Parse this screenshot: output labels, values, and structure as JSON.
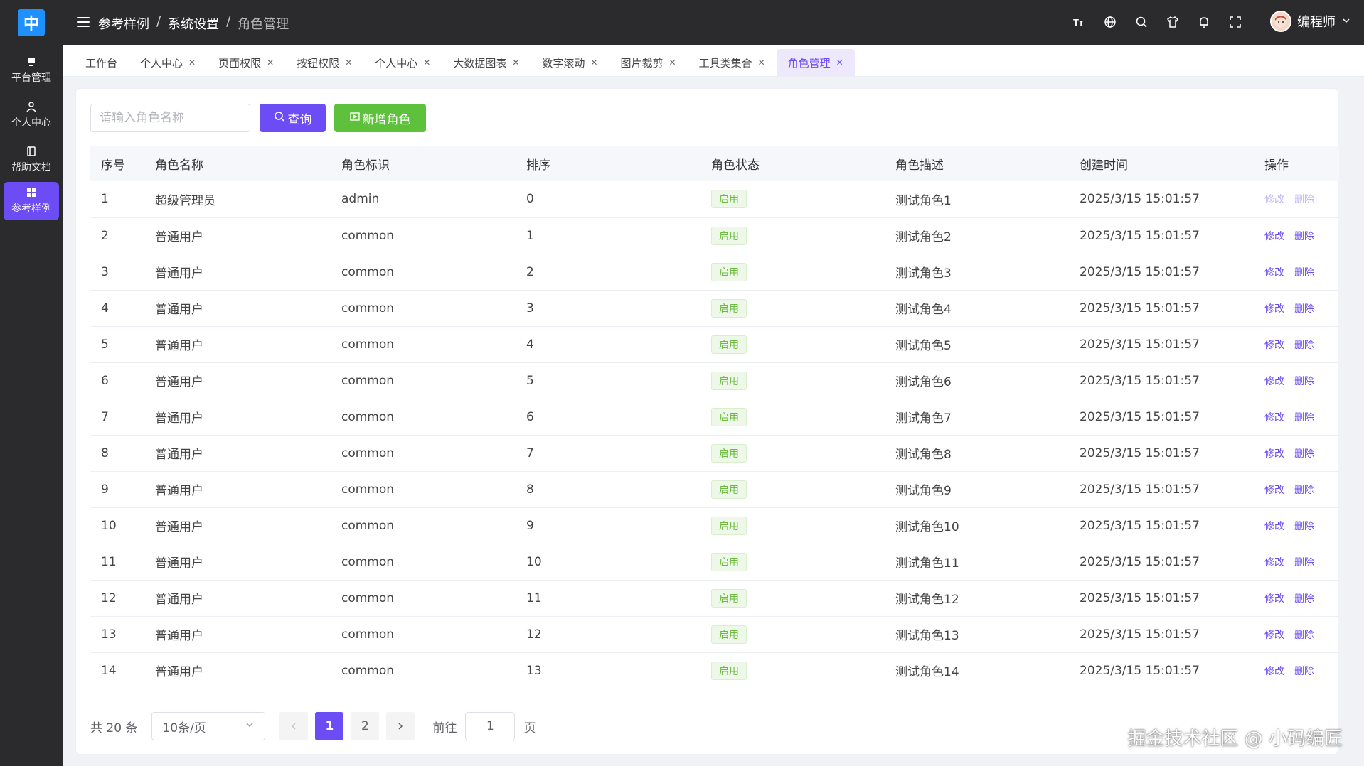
{
  "colors": {
    "accent": "#6c4cf5",
    "success": "#5ec13c",
    "sidebar": "#2b2b2d"
  },
  "logo": {
    "text": "中"
  },
  "sidebar": {
    "items": [
      {
        "label": "平台管理",
        "icon": "monitor-icon"
      },
      {
        "label": "个人中心",
        "icon": "user-icon"
      },
      {
        "label": "帮助文档",
        "icon": "book-icon"
      },
      {
        "label": "参考样例",
        "icon": "grid-icon",
        "active": true
      }
    ]
  },
  "header": {
    "breadcrumb": [
      "参考样例",
      "系统设置",
      "角色管理"
    ],
    "separator": "/",
    "icons": [
      "font-size-icon",
      "globe-icon",
      "search-icon",
      "shirt-icon",
      "bell-icon",
      "fullscreen-icon"
    ],
    "user_name": "编程师"
  },
  "tabs": [
    {
      "label": "工作台",
      "closable": false
    },
    {
      "label": "个人中心",
      "closable": true
    },
    {
      "label": "页面权限",
      "closable": true
    },
    {
      "label": "按钮权限",
      "closable": true
    },
    {
      "label": "个人中心",
      "closable": true
    },
    {
      "label": "大数据图表",
      "closable": true
    },
    {
      "label": "数字滚动",
      "closable": true
    },
    {
      "label": "图片裁剪",
      "closable": true
    },
    {
      "label": "工具类集合",
      "closable": true
    },
    {
      "label": "角色管理",
      "closable": true,
      "active": true
    }
  ],
  "toolbar": {
    "search_placeholder": "请输入角色名称",
    "query_label": "查询",
    "add_label": "新增角色"
  },
  "table": {
    "columns": [
      "序号",
      "角色名称",
      "角色标识",
      "排序",
      "角色状态",
      "角色描述",
      "创建时间",
      "操作"
    ],
    "edit_label": "修改",
    "delete_label": "删除",
    "rows": [
      {
        "no": "1",
        "name": "超级管理员",
        "key": "admin",
        "sort": "0",
        "status": "启用",
        "desc": "测试角色1",
        "time": "2025/3/15 15:01:57",
        "disabled": true
      },
      {
        "no": "2",
        "name": "普通用户",
        "key": "common",
        "sort": "1",
        "status": "启用",
        "desc": "测试角色2",
        "time": "2025/3/15 15:01:57"
      },
      {
        "no": "3",
        "name": "普通用户",
        "key": "common",
        "sort": "2",
        "status": "启用",
        "desc": "测试角色3",
        "time": "2025/3/15 15:01:57"
      },
      {
        "no": "4",
        "name": "普通用户",
        "key": "common",
        "sort": "3",
        "status": "启用",
        "desc": "测试角色4",
        "time": "2025/3/15 15:01:57"
      },
      {
        "no": "5",
        "name": "普通用户",
        "key": "common",
        "sort": "4",
        "status": "启用",
        "desc": "测试角色5",
        "time": "2025/3/15 15:01:57"
      },
      {
        "no": "6",
        "name": "普通用户",
        "key": "common",
        "sort": "5",
        "status": "启用",
        "desc": "测试角色6",
        "time": "2025/3/15 15:01:57"
      },
      {
        "no": "7",
        "name": "普通用户",
        "key": "common",
        "sort": "6",
        "status": "启用",
        "desc": "测试角色7",
        "time": "2025/3/15 15:01:57"
      },
      {
        "no": "8",
        "name": "普通用户",
        "key": "common",
        "sort": "7",
        "status": "启用",
        "desc": "测试角色8",
        "time": "2025/3/15 15:01:57"
      },
      {
        "no": "9",
        "name": "普通用户",
        "key": "common",
        "sort": "8",
        "status": "启用",
        "desc": "测试角色9",
        "time": "2025/3/15 15:01:57"
      },
      {
        "no": "10",
        "name": "普通用户",
        "key": "common",
        "sort": "9",
        "status": "启用",
        "desc": "测试角色10",
        "time": "2025/3/15 15:01:57"
      },
      {
        "no": "11",
        "name": "普通用户",
        "key": "common",
        "sort": "10",
        "status": "启用",
        "desc": "测试角色11",
        "time": "2025/3/15 15:01:57"
      },
      {
        "no": "12",
        "name": "普通用户",
        "key": "common",
        "sort": "11",
        "status": "启用",
        "desc": "测试角色12",
        "time": "2025/3/15 15:01:57"
      },
      {
        "no": "13",
        "name": "普通用户",
        "key": "common",
        "sort": "12",
        "status": "启用",
        "desc": "测试角色13",
        "time": "2025/3/15 15:01:57"
      },
      {
        "no": "14",
        "name": "普通用户",
        "key": "common",
        "sort": "13",
        "status": "启用",
        "desc": "测试角色14",
        "time": "2025/3/15 15:01:57"
      }
    ]
  },
  "pagination": {
    "total_text": "共 20 条",
    "page_size": "10条/页",
    "pages": [
      "1",
      "2"
    ],
    "current": "1",
    "goto_label": "前往",
    "goto_value": "1",
    "page_suffix": "页"
  },
  "watermark": "掘金技术社区 @ 小码编匠"
}
